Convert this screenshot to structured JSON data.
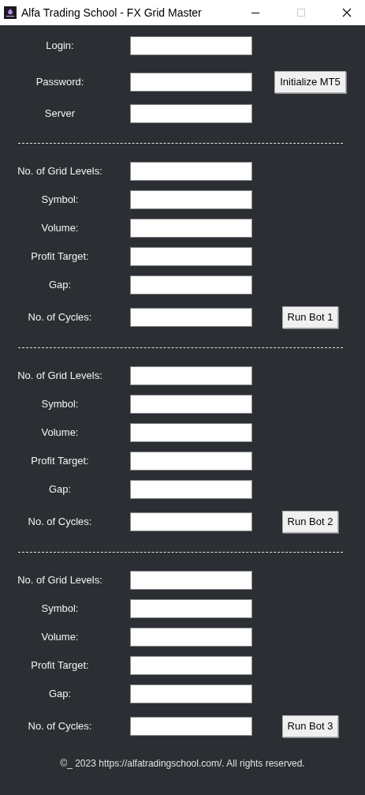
{
  "window": {
    "title": "Alfa Trading School - FX Grid Master"
  },
  "login_fields": [
    {
      "label": "Login:"
    },
    {
      "label": "Password:",
      "button": "Initialize MT5"
    },
    {
      "label": "Server"
    }
  ],
  "bots": [
    {
      "fields": [
        {
          "label": "No. of Grid Levels:"
        },
        {
          "label": "Symbol:"
        },
        {
          "label": "Volume:"
        },
        {
          "label": "Profit Target:"
        },
        {
          "label": "Gap:"
        },
        {
          "label": "No. of Cycles:",
          "button": "Run Bot 1"
        }
      ]
    },
    {
      "fields": [
        {
          "label": "No. of Grid Levels:"
        },
        {
          "label": "Symbol:"
        },
        {
          "label": "Volume:"
        },
        {
          "label": "Profit Target:"
        },
        {
          "label": "Gap:"
        },
        {
          "label": "No. of Cycles:",
          "button": "Run Bot 2"
        }
      ]
    },
    {
      "fields": [
        {
          "label": "No. of Grid Levels:"
        },
        {
          "label": "Symbol:"
        },
        {
          "label": "Volume:"
        },
        {
          "label": "Profit Target:"
        },
        {
          "label": "Gap:"
        },
        {
          "label": "No. of Cycles:",
          "button": "Run Bot 3"
        }
      ]
    }
  ],
  "footer": "©_ 2023 https://alfatradingschool.com/. All rights reserved."
}
